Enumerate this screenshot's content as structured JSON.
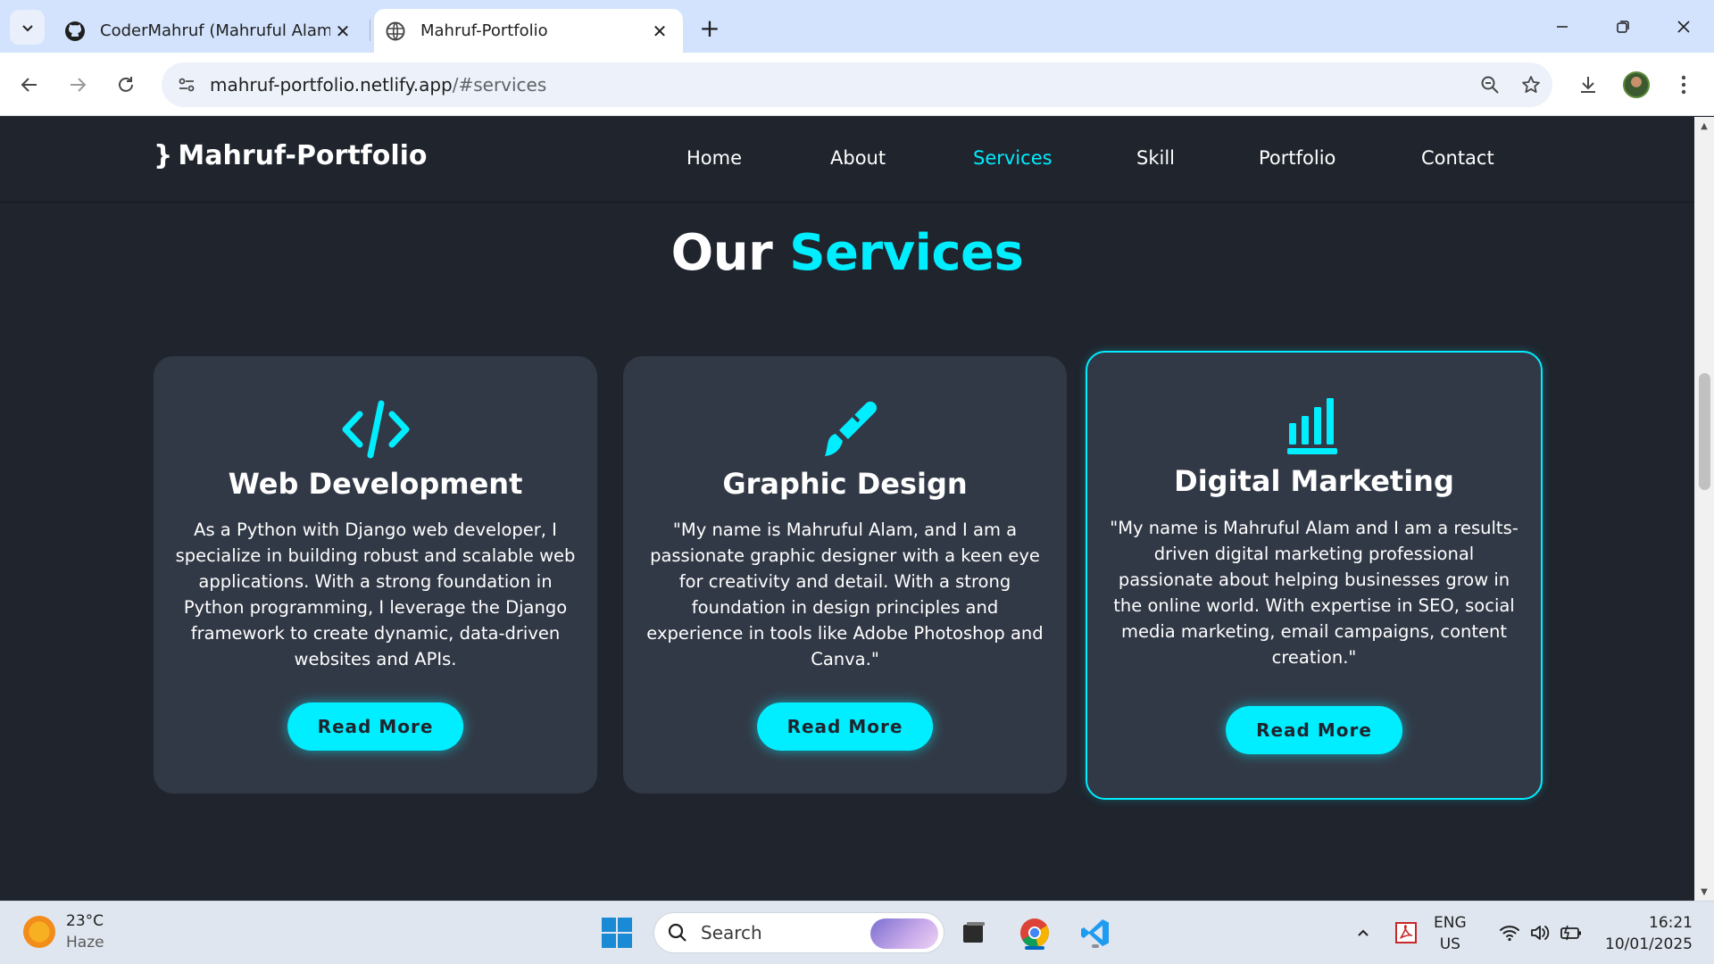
{
  "browser": {
    "tabs": [
      {
        "title": "CoderMahruf (Mahruful Alam)",
        "icon": "github-icon",
        "active": false
      },
      {
        "title": "Mahruf-Portfolio",
        "icon": "globe-icon",
        "active": true
      }
    ],
    "address": {
      "host": "mahruf-portfolio.netlify.app",
      "path": "/#services"
    }
  },
  "site": {
    "logo": "Mahruf-Portfolio",
    "nav": [
      "Home",
      "About",
      "Services",
      "Skill",
      "Portfolio",
      "Contact"
    ],
    "active_nav": "Services",
    "section_title": {
      "plain": "Our",
      "highlight": "Services"
    },
    "accent_color": "#00eeff",
    "background_color": "#1f242d",
    "card_color": "#323946",
    "services": [
      {
        "icon": "code-icon",
        "title": "Web Development",
        "description": "As a Python with Django web developer, I specialize in building robust and scalable web applications. With a strong foundation in Python programming, I leverage the Django framework to create dynamic, data-driven websites and APIs.",
        "button": "Read More"
      },
      {
        "icon": "paintbrush-icon",
        "title": "Graphic Design",
        "description": "\"My name is Mahruful Alam, and I am a passionate graphic designer with a keen eye for creativity and detail. With a strong foundation in design principles and experience in tools like Adobe Photoshop and Canva.\"",
        "button": "Read More"
      },
      {
        "icon": "bar-chart-icon",
        "title": "Digital Marketing",
        "description": "\"My name is Mahruful Alam and I am a results-driven digital marketing professional passionate about helping businesses grow in the online world. With expertise in SEO, social media marketing, email campaigns, content creation.\"",
        "button": "Read More"
      }
    ]
  },
  "taskbar": {
    "weather": {
      "temp": "23°C",
      "condition": "Haze"
    },
    "search_label": "Search",
    "language": {
      "line1": "ENG",
      "line2": "US"
    },
    "clock": {
      "time": "16:21",
      "date": "10/01/2025"
    }
  }
}
